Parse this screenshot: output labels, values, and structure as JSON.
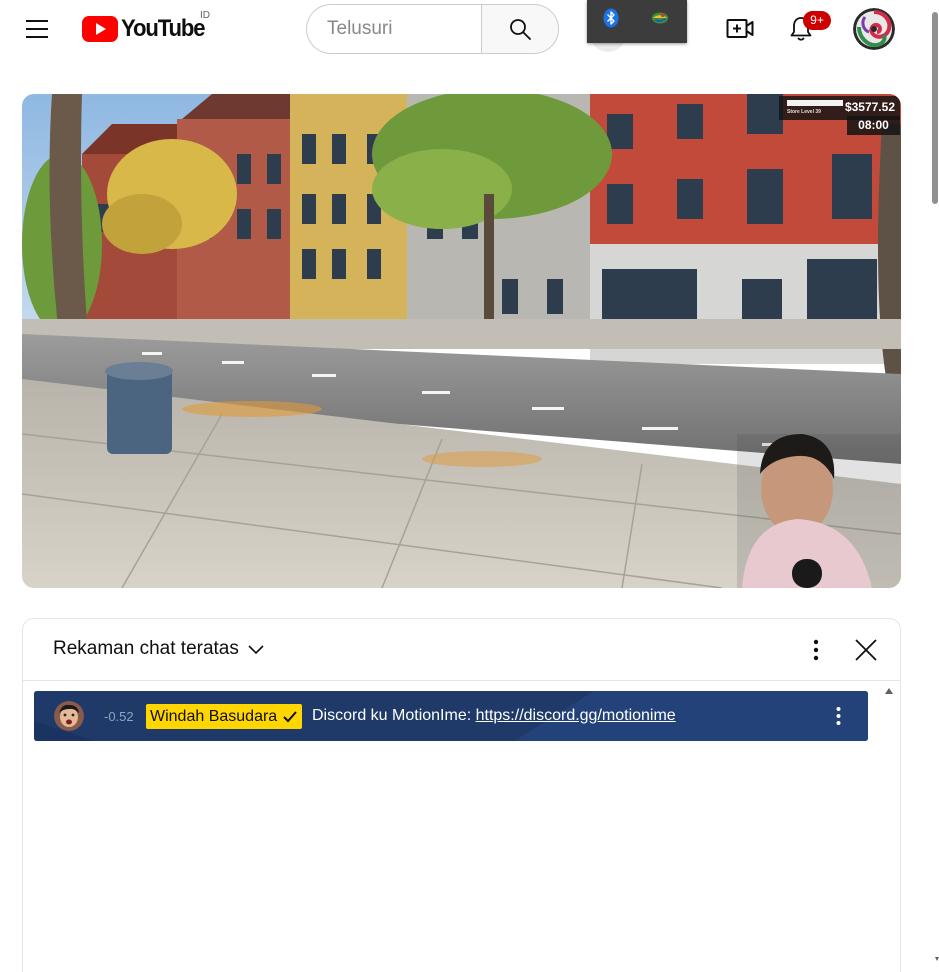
{
  "header": {
    "menu_icon": "hamburger-menu-icon",
    "logo_text": "YouTube",
    "region_code": "ID",
    "search": {
      "placeholder": "Telusuri",
      "value": ""
    },
    "search_icon": "search-icon",
    "tray_icons": [
      "bluetooth-icon",
      "network-globe-icon"
    ],
    "create_icon": "video-create-icon",
    "notifications_icon": "bell-icon",
    "notifications_count": "9+",
    "avatar_icon": "user-avatar"
  },
  "video": {
    "hud_money": "$3577.52",
    "hud_level": "Store Level 39",
    "hud_time": "08:00"
  },
  "chat": {
    "mode_label": "Rekaman chat teratas",
    "mode_icon": "chevron-down-icon",
    "more_icon": "more-vert-icon",
    "close_icon": "close-icon",
    "pinned": {
      "time": "-0.52",
      "author": "Windah Basudara",
      "verified_icon": "checkmark-icon",
      "message_text": "Discord ku MotionIme: ",
      "link_text": "https://discord.gg/motionime",
      "more_icon": "more-vert-icon"
    }
  },
  "colors": {
    "youtube_red": "#ff0000",
    "notification_red": "#cc0000",
    "pinned_background": "#1f3a68",
    "author_badge": "#ffd600"
  }
}
